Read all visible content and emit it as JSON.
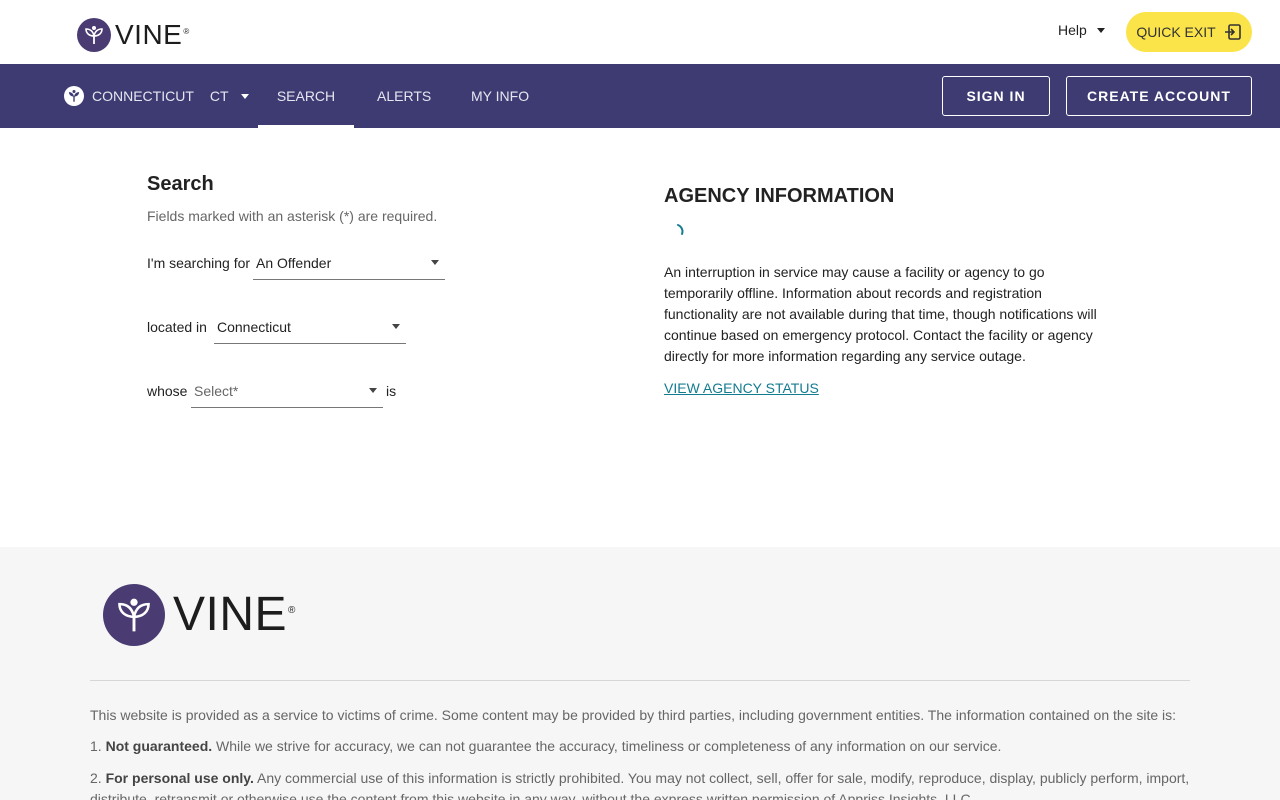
{
  "header": {
    "logo_text": "VINE",
    "logo_reg": "®",
    "help_label": "Help",
    "quick_exit_label": "QUICK EXIT"
  },
  "nav": {
    "state_name": "CONNECTICUT",
    "state_abbr": "CT",
    "items": [
      {
        "label": "SEARCH",
        "active": true
      },
      {
        "label": "ALERTS",
        "active": false
      },
      {
        "label": "MY INFO",
        "active": false
      }
    ],
    "sign_in_label": "SIGN IN",
    "create_account_label": "CREATE ACCOUNT"
  },
  "search": {
    "title": "Search",
    "note": "Fields marked with an asterisk (*) are required.",
    "row1_label": "I'm searching for",
    "row1_value": "An Offender",
    "row2_label": "located in",
    "row2_value": "Connecticut",
    "row3_label": "whose",
    "row3_placeholder": "Select*",
    "row3_suffix": "is"
  },
  "agency": {
    "title": "AGENCY INFORMATION",
    "text": "An interruption in service may cause a facility or agency to go temporarily offline. Information about records and registration functionality are not available during that time, though notifications will continue based on emergency protocol. Contact the facility or agency directly for more information regarding any service outage.",
    "link_label": "VIEW AGENCY STATUS"
  },
  "footer": {
    "logo_text": "VINE",
    "logo_reg": "®",
    "intro": "This website is provided as a service to victims of crime. Some content may be provided by third parties, including government entities. The information contained on the site is:",
    "item1_num": "1.",
    "item1_bold": "Not guaranteed.",
    "item1_text": "While we strive for accuracy, we can not guarantee the accuracy, timeliness or completeness of any information on our service.",
    "item2_num": "2.",
    "item2_bold": "For personal use only.",
    "item2_text": "Any commercial use of this information is strictly prohibited. You may not collect, sell, offer for sale, modify, reproduce, display, publicly perform, import, distribute, retransmit or otherwise use the content from this website in any way, without the express written permission of Appriss Insights, LLC."
  },
  "colors": {
    "nav_bg": "#3e3b73",
    "brand_purple": "#4a3c72",
    "quick_exit_bg": "#fbe44a",
    "link": "#137c90",
    "footer_bg": "#f6f6f6"
  },
  "icons": {
    "logo": "vine-sprout-icon",
    "quick_exit": "exit-door-icon",
    "state": "vine-sprout-icon",
    "dropdown": "caret-down-icon",
    "loading": "spinner-icon"
  }
}
